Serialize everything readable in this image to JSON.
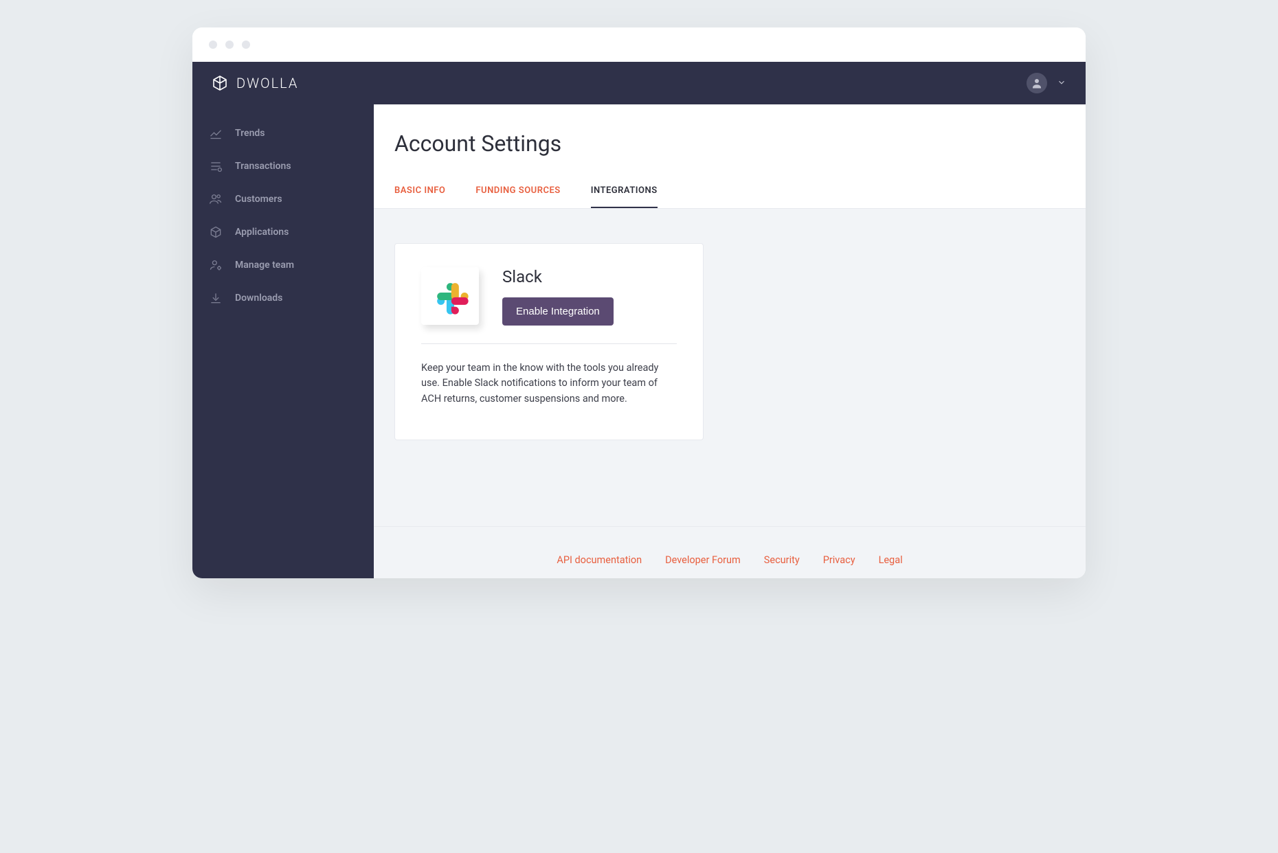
{
  "brand": {
    "name": "DWOLLA"
  },
  "sidebar": {
    "items": [
      {
        "label": "Trends",
        "icon": "trends"
      },
      {
        "label": "Transactions",
        "icon": "transactions"
      },
      {
        "label": "Customers",
        "icon": "customers"
      },
      {
        "label": "Applications",
        "icon": "applications"
      },
      {
        "label": "Manage team",
        "icon": "manage-team"
      },
      {
        "label": "Downloads",
        "icon": "downloads"
      }
    ]
  },
  "page": {
    "title": "Account Settings",
    "tabs": [
      {
        "label": "BASIC INFO",
        "active": false
      },
      {
        "label": "FUNDING SOURCES",
        "active": false
      },
      {
        "label": "INTEGRATIONS",
        "active": true
      }
    ]
  },
  "integration_card": {
    "title": "Slack",
    "button_label": "Enable Integration",
    "description": "Keep your team in the know with the tools you already use. Enable Slack notifications to inform your team of ACH returns, customer suspensions and more."
  },
  "footer": {
    "links": [
      "API documentation",
      "Developer Forum",
      "Security",
      "Privacy",
      "Legal"
    ]
  }
}
